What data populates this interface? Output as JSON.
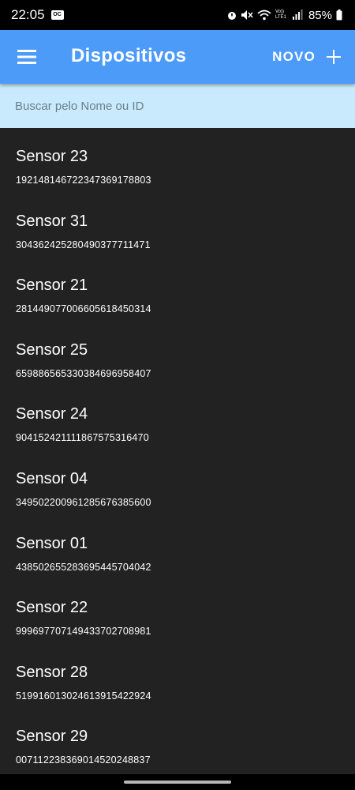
{
  "status_bar": {
    "time": "22:05",
    "notification_badge": "OC",
    "battery": "85%",
    "network_label": "Vo)) LTE1"
  },
  "app_bar": {
    "title": "Dispositivos",
    "new_label": "NOVO",
    "background": "#4c9bf9"
  },
  "search": {
    "placeholder": "Buscar pelo Nome ou ID",
    "value": ""
  },
  "devices": [
    {
      "name": "Sensor 23",
      "id": "192148146722347369178803"
    },
    {
      "name": "Sensor 31",
      "id": "304362425280490377711471"
    },
    {
      "name": "Sensor 21",
      "id": "281449077006605618450314"
    },
    {
      "name": "Sensor 25",
      "id": "659886565330384696958407"
    },
    {
      "name": "Sensor 24",
      "id": "904152421111867575316470"
    },
    {
      "name": "Sensor 04",
      "id": "349502200961285676385600"
    },
    {
      "name": "Sensor 01",
      "id": "438502655283695445704042"
    },
    {
      "name": "Sensor 22",
      "id": "999697707149433702708981"
    },
    {
      "name": "Sensor 28",
      "id": "519916013024613915422924"
    },
    {
      "name": "Sensor 29",
      "id": "007112238369014520248837"
    }
  ]
}
